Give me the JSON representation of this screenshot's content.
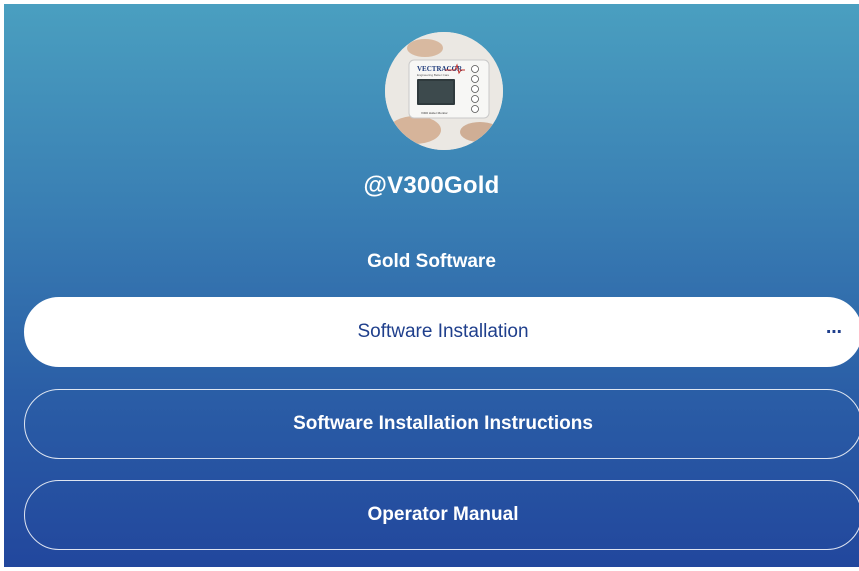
{
  "profile": {
    "handle": "@V300Gold",
    "avatar_icon": "device-photo"
  },
  "section": {
    "title": "Gold Software"
  },
  "links": [
    {
      "label": "Software Installation",
      "style": "filled",
      "more_icon": "more-horizontal-icon",
      "more_glyph": "⋯"
    },
    {
      "label": "Software Installation Instructions",
      "style": "outline"
    },
    {
      "label": "Operator Manual",
      "style": "outline"
    }
  ],
  "device": {
    "brand_text": "VECTRACOR",
    "tagline": "Engineering Better Care",
    "model_text": "V300 Holter Monitor"
  },
  "colors": {
    "gradient_top": "#4a9fc0",
    "gradient_bottom": "#22479d",
    "primary_button_text": "#1f3f8c"
  }
}
